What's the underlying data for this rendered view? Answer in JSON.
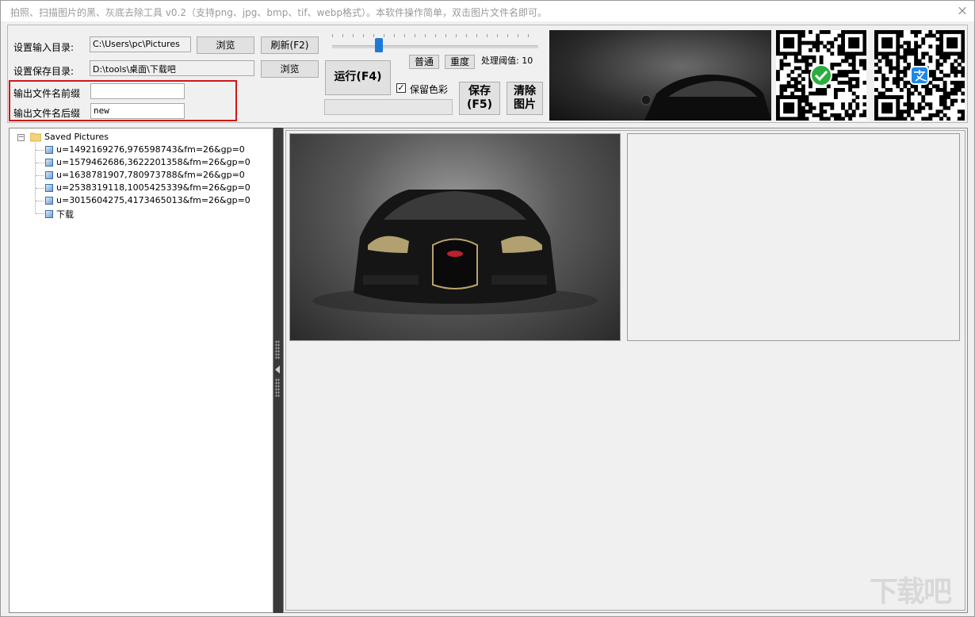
{
  "window": {
    "title": "拍照、扫描图片的黑、灰底去除工具 v0.2（支持png、jpg、bmp、tif、webp格式）。本软件操作简单，双击图片文件名即可。"
  },
  "settings": {
    "input_dir_label": "设置输入目录:",
    "input_dir_value": "C:\\Users\\pc\\Pictures",
    "browse_input_label": "浏览",
    "refresh_label": "刷新(F2)",
    "save_dir_label": "设置保存目录:",
    "save_dir_value": "D:\\tools\\桌面\\下载吧",
    "browse_save_label": "浏览",
    "prefix_label": "输出文件名前缀",
    "prefix_value": "",
    "suffix_label": "输出文件名后缀",
    "suffix_value": "new"
  },
  "controls": {
    "run_label": "运行(F4)",
    "normal_label": "普通",
    "heavy_label": "重度",
    "threshold_label": "处理阈值:",
    "threshold_value": "10",
    "keep_color_label": "保留色彩",
    "keep_color_checked": true,
    "save_label": "保存\n(F5)",
    "clear_label": "清除\n图片"
  },
  "tree": {
    "root_label": "Saved Pictures",
    "items": [
      {
        "label": "u=1492169276,976598743&fm=26&gp=0"
      },
      {
        "label": "u=1579462686,3622201358&fm=26&gp=0"
      },
      {
        "label": "u=1638781907,780973788&fm=26&gp=0"
      },
      {
        "label": "u=2538319118,1005425339&fm=26&gp=0"
      },
      {
        "label": "u=3015604275,4173465013&fm=26&gp=0"
      },
      {
        "label": "下载"
      }
    ]
  },
  "watermark": "下载吧",
  "colors": {
    "accent": "#1e7ad6",
    "highlight_box": "#d01818",
    "wechat_green": "#2bad3f",
    "alipay_blue": "#1e88e5"
  }
}
